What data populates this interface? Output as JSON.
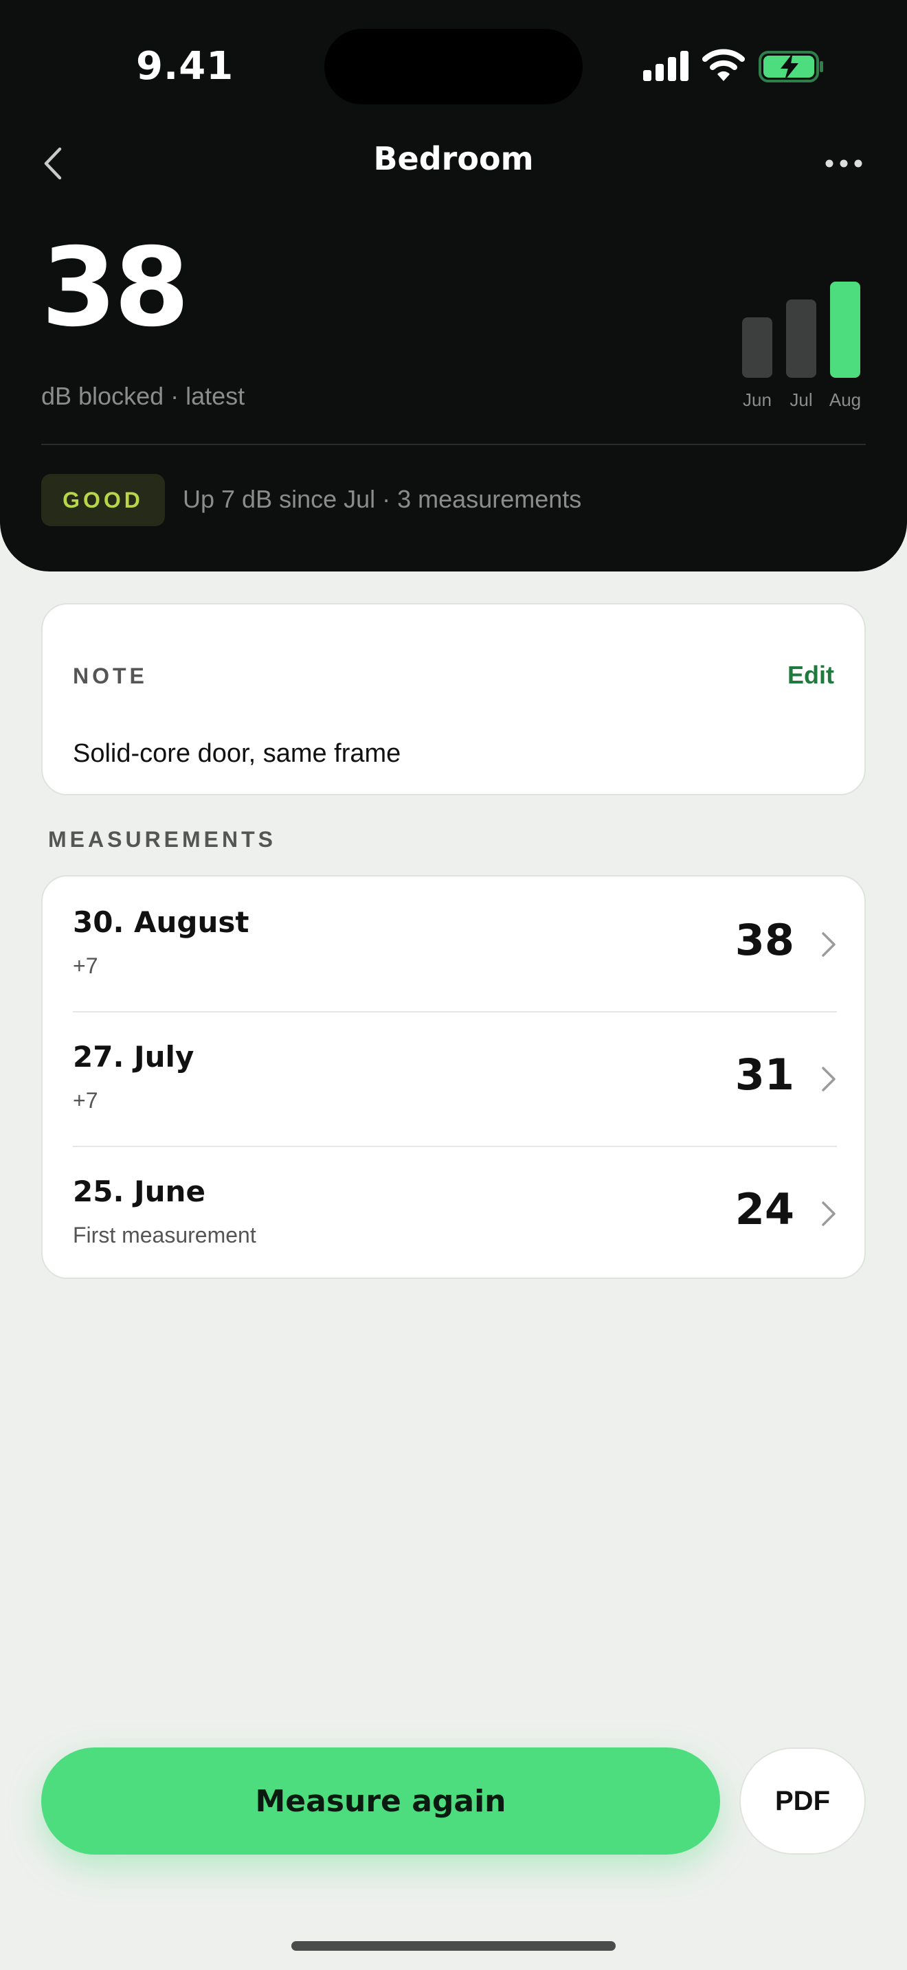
{
  "status_bar": {
    "time": "9.41",
    "icons": [
      "signal-icon",
      "wifi-icon",
      "battery-charging-icon"
    ],
    "battery_color": "#4ddd7e"
  },
  "nav": {
    "title": "Bedroom",
    "back_icon": "chevron-left-icon",
    "more_icon": "more-horizontal-icon"
  },
  "summary": {
    "value": "38",
    "caption": "dB blocked · latest",
    "badge": "GOOD",
    "trend": "Up 7 dB since Jul · 3 measurements"
  },
  "chart_data": {
    "type": "bar",
    "categories": [
      "Jun",
      "Jul",
      "Aug"
    ],
    "values": [
      24,
      31,
      38
    ],
    "ylim": [
      0,
      38
    ],
    "highlight": "Aug",
    "colors": {
      "bar": "#3d3e3e",
      "highlight": "#4ddd7e"
    }
  },
  "note": {
    "label": "NOTE",
    "edit_label": "Edit",
    "text": "Solid-core door, same frame"
  },
  "measurements": {
    "section_label": "MEASUREMENTS",
    "rows": [
      {
        "date": "30. August",
        "detail": "+7",
        "value": "38"
      },
      {
        "date": "27. July",
        "detail": "+7",
        "value": "31"
      },
      {
        "date": "25. June",
        "detail": "First measurement",
        "value": "24"
      }
    ]
  },
  "actions": {
    "measure_again": "Measure again",
    "pdf": "PDF"
  },
  "colors": {
    "accent": "#4ddd7e",
    "badge_text": "#b8d647",
    "edit_link": "#1f7a3e",
    "header_bg": "#0d0e0e",
    "page_bg": "#eef0ed"
  }
}
